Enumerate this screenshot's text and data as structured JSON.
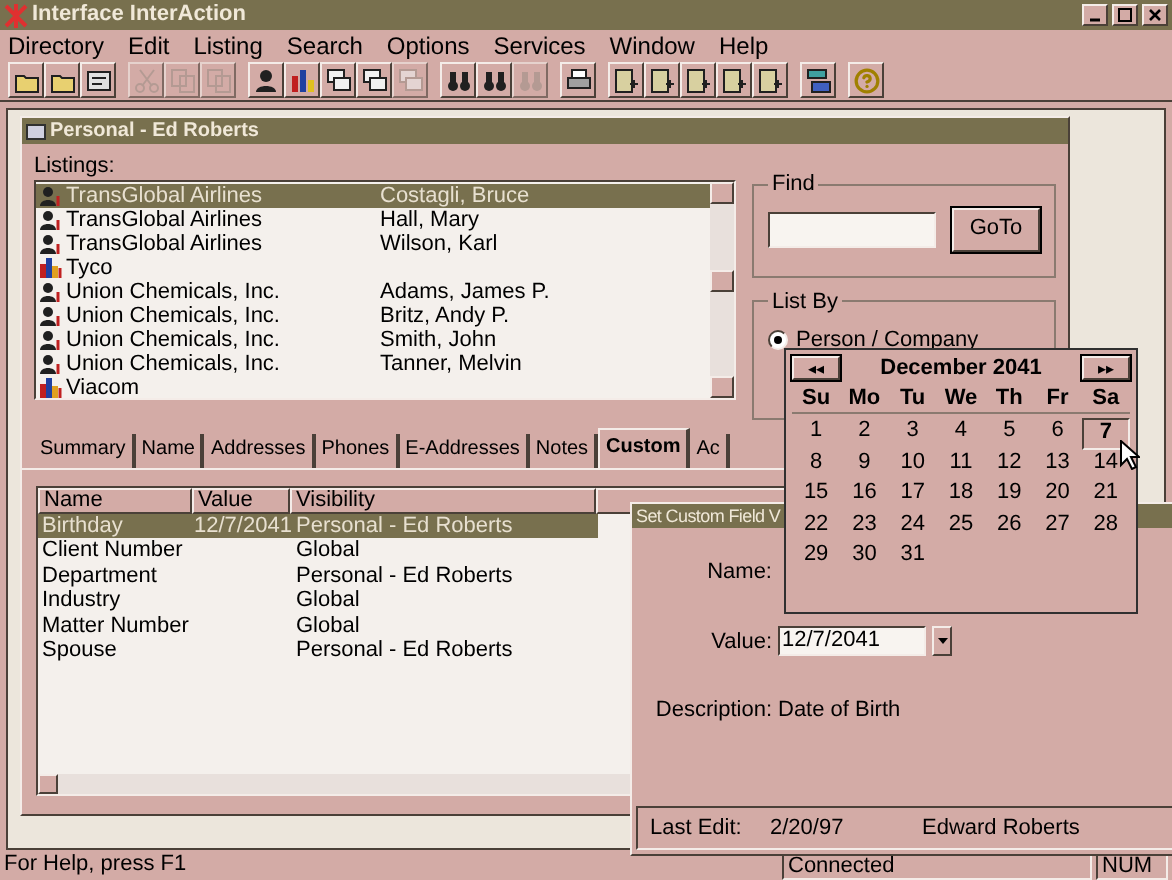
{
  "window": {
    "title": "Interface InterAction"
  },
  "menu": [
    "Directory",
    "Edit",
    "Listing",
    "Search",
    "Options",
    "Services",
    "Window",
    "Help"
  ],
  "toolbar": [
    [
      {
        "kind": "folder",
        "disabled": false
      },
      {
        "kind": "folder",
        "disabled": false
      },
      {
        "kind": "card",
        "disabled": false
      }
    ],
    [
      {
        "kind": "scissors",
        "disabled": true
      },
      {
        "kind": "pages",
        "disabled": true
      },
      {
        "kind": "pages",
        "disabled": true
      }
    ],
    [
      {
        "kind": "person",
        "disabled": false
      },
      {
        "kind": "company",
        "disabled": false
      },
      {
        "kind": "windows",
        "disabled": false
      },
      {
        "kind": "windows",
        "disabled": false
      },
      {
        "kind": "windows",
        "disabled": true
      }
    ],
    [
      {
        "kind": "binoculars",
        "disabled": false
      },
      {
        "kind": "binoculars",
        "disabled": false
      },
      {
        "kind": "binoculars",
        "disabled": true
      }
    ],
    [
      {
        "kind": "printer",
        "disabled": false
      }
    ],
    [
      {
        "kind": "document",
        "disabled": false
      },
      {
        "kind": "document",
        "disabled": false
      },
      {
        "kind": "document",
        "disabled": false
      },
      {
        "kind": "document",
        "disabled": false
      },
      {
        "kind": "document",
        "disabled": false
      }
    ],
    [
      {
        "kind": "stack",
        "disabled": false
      }
    ],
    [
      {
        "kind": "help",
        "disabled": false
      }
    ]
  ],
  "personal_window": {
    "title": "Personal - Ed Roberts",
    "listings_label": "Listings:",
    "listings": [
      {
        "kind": "person",
        "company": "TransGlobal Airlines",
        "person": "Costagli, Bruce",
        "selected": true
      },
      {
        "kind": "person",
        "company": "TransGlobal Airlines",
        "person": "Hall, Mary",
        "selected": false
      },
      {
        "kind": "person",
        "company": "TransGlobal Airlines",
        "person": "Wilson, Karl",
        "selected": false
      },
      {
        "kind": "company",
        "company": "Tyco",
        "selected": false
      },
      {
        "kind": "person",
        "company": "Union Chemicals, Inc.",
        "person": "Adams, James P.",
        "selected": false
      },
      {
        "kind": "person",
        "company": "Union Chemicals, Inc.",
        "person": "Britz, Andy P.",
        "selected": false
      },
      {
        "kind": "person",
        "company": "Union Chemicals, Inc.",
        "person": "Smith, John",
        "selected": false
      },
      {
        "kind": "person",
        "company": "Union Chemicals, Inc.",
        "person": "Tanner, Melvin",
        "selected": false
      },
      {
        "kind": "company",
        "company": "Viacom",
        "selected": false
      }
    ],
    "find": {
      "label": "Find",
      "button": "GoTo"
    },
    "list_by": {
      "label": "List By",
      "options": [
        {
          "label": "Person / Company",
          "selected": true
        }
      ]
    },
    "tabs": [
      {
        "label": "Summary",
        "selected": false
      },
      {
        "label": "Name",
        "selected": false
      },
      {
        "label": "Addresses",
        "selected": false
      },
      {
        "label": "Phones",
        "selected": false
      },
      {
        "label": "E-Addresses",
        "selected": false
      },
      {
        "label": "Notes",
        "selected": false
      },
      {
        "label": "Custom",
        "selected": true
      },
      {
        "label": "Ac",
        "selected": false
      }
    ],
    "table": {
      "columns": [
        "Name",
        "Value",
        "Visibility"
      ],
      "rows": [
        {
          "name": "Birthday",
          "value": "12/7/2041",
          "visibility": "Personal - Ed Roberts",
          "selected": true
        },
        {
          "name": "Client Number",
          "visibility": "Global",
          "selected": false
        },
        {
          "name": "Department",
          "visibility": "Personal - Ed Roberts",
          "selected": false
        },
        {
          "name": "Industry",
          "visibility": "Global",
          "selected": false
        },
        {
          "name": "Matter Number",
          "visibility": "Global",
          "selected": false
        },
        {
          "name": "Spouse",
          "visibility": "Personal - Ed Roberts",
          "selected": false
        }
      ]
    }
  },
  "dialog": {
    "title": "Set Custom Field V",
    "name_label": "Name:",
    "value_label": "Value:",
    "value": "12/7/2041",
    "description_label": "Description:",
    "description": "Date of Birth",
    "last_edit_label": "Last Edit:",
    "last_edit_date": "2/20/97",
    "last_edit_user": "Edward Roberts"
  },
  "calendar": {
    "prev": "◂◂",
    "next": "▸▸",
    "month": "December 2041",
    "weekdays": [
      "Su",
      "Mo",
      "Tu",
      "We",
      "Th",
      "Fr",
      "Sa"
    ],
    "days": [
      {
        "day": "1",
        "selected": false
      },
      {
        "day": "2",
        "selected": false
      },
      {
        "day": "3",
        "selected": false
      },
      {
        "day": "4",
        "selected": false
      },
      {
        "day": "5",
        "selected": false
      },
      {
        "day": "6",
        "selected": false
      },
      {
        "day": "7",
        "selected": true
      },
      {
        "day": "8",
        "selected": false
      },
      {
        "day": "9",
        "selected": false
      },
      {
        "day": "10",
        "selected": false
      },
      {
        "day": "11",
        "selected": false
      },
      {
        "day": "12",
        "selected": false
      },
      {
        "day": "13",
        "selected": false
      },
      {
        "day": "14",
        "selected": false
      },
      {
        "day": "15",
        "selected": false
      },
      {
        "day": "16",
        "selected": false
      },
      {
        "day": "17",
        "selected": false
      },
      {
        "day": "18",
        "selected": false
      },
      {
        "day": "19",
        "selected": false
      },
      {
        "day": "20",
        "selected": false
      },
      {
        "day": "21",
        "selected": false
      },
      {
        "day": "22",
        "selected": false
      },
      {
        "day": "23",
        "selected": false
      },
      {
        "day": "24",
        "selected": false
      },
      {
        "day": "25",
        "selected": false
      },
      {
        "day": "26",
        "selected": false
      },
      {
        "day": "27",
        "selected": false
      },
      {
        "day": "28",
        "selected": false
      },
      {
        "day": "29",
        "selected": false
      },
      {
        "day": "30",
        "selected": false
      },
      {
        "day": "31",
        "selected": false
      }
    ]
  },
  "status_bar": [
    "For Help, press F1",
    "Connected",
    "NUM"
  ]
}
